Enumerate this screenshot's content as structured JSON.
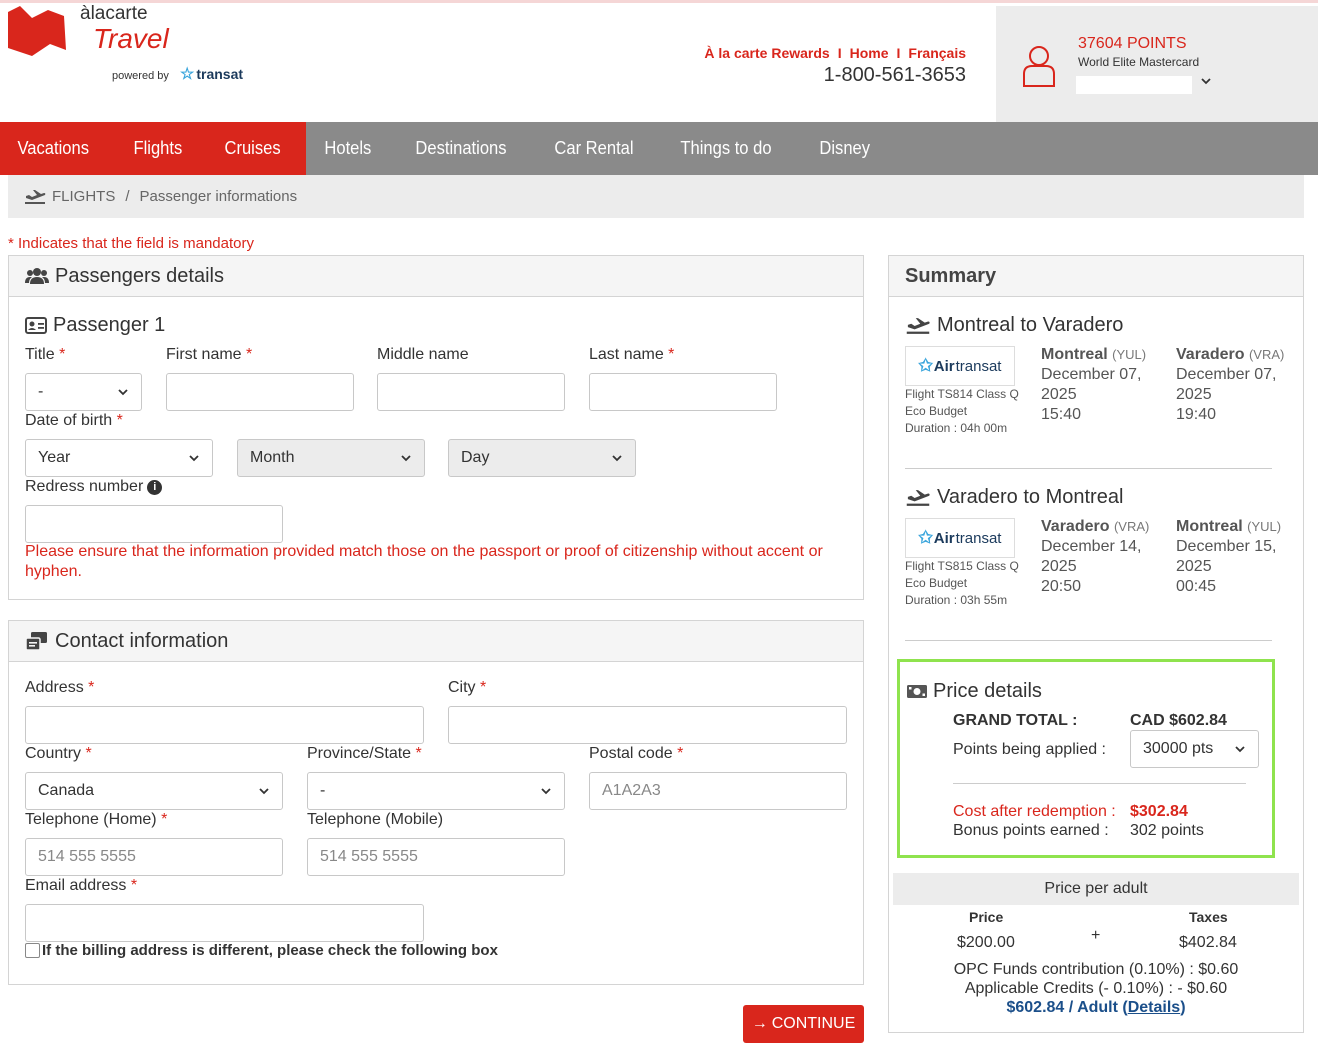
{
  "brand": {
    "ala": "àlacarte",
    "travel": "Travel",
    "powered_by": "powered by",
    "transat": "transat"
  },
  "top_links": {
    "rewards": "À la carte Rewards",
    "home": "Home",
    "language": "Français",
    "separator": "I",
    "phone": "1-800-561-3653"
  },
  "account": {
    "points": "37604 POINTS",
    "card": "World Elite Mastercard"
  },
  "nav": {
    "items": [
      "Vacations",
      "Flights",
      "Cruises",
      "Hotels",
      "Destinations",
      "Car Rental",
      "Things to do",
      "Disney"
    ]
  },
  "breadcrumb": {
    "section": "FLIGHTS",
    "separator": "/",
    "current": "Passenger informations"
  },
  "mandatory_note": "* Indicates that the field is mandatory",
  "passengers": {
    "title": "Passengers details",
    "passenger_title": "Passenger 1",
    "title_label": "Title",
    "title_value": "-",
    "first_name_label": "First name",
    "middle_name_label": "Middle name",
    "last_name_label": "Last name",
    "dob_label": "Date of birth",
    "dob_year": "Year",
    "dob_month": "Month",
    "dob_day": "Day",
    "redress_label": "Redress number",
    "info_glyph": "i",
    "warning": "Please ensure that the information provided match those on the passport or proof of citizenship without accent or hyphen.",
    "required_mark": "*"
  },
  "contact": {
    "title": "Contact information",
    "address_label": "Address",
    "city_label": "City",
    "country_label": "Country",
    "country_value": "Canada",
    "province_label": "Province/State",
    "province_value": "-",
    "postal_label": "Postal code",
    "postal_placeholder": "A1A2A3",
    "tel_home_label": "Telephone (Home)",
    "tel_home_placeholder": "514 555 5555",
    "tel_mobile_label": "Telephone (Mobile)",
    "tel_mobile_placeholder": "514 555 5555",
    "email_label": "Email address",
    "billing_checkbox": "If the billing address is different, please check the following box"
  },
  "continue_button": {
    "arrow": "→",
    "label": "CONTINUE"
  },
  "summary": {
    "title": "Summary",
    "airline": {
      "air": "Air",
      "transat": "transat"
    },
    "outbound": {
      "route": "Montreal to Varadero",
      "flight": "Flight TS814 Class Q Eco Budget",
      "duration": "Duration : 04h 00m",
      "from_city": "Montreal",
      "from_code": "(YUL)",
      "from_date": "December 07, 2025",
      "from_time": "15:40",
      "to_city": "Varadero",
      "to_code": "(VRA)",
      "to_date": "December 07, 2025",
      "to_time": "19:40"
    },
    "return": {
      "route": "Varadero to Montreal",
      "flight": "Flight TS815 Class Q Eco Budget",
      "duration": "Duration : 03h 55m",
      "from_city": "Varadero",
      "from_code": "(VRA)",
      "from_date": "December 14, 2025",
      "from_time": "20:50",
      "to_city": "Montreal",
      "to_code": "(YUL)",
      "to_date": "December 15, 2025",
      "to_time": "00:45"
    },
    "price_details": {
      "title": "Price details",
      "grand_total_label": "GRAND TOTAL :",
      "grand_total_value": "CAD $602.84",
      "points_label": "Points being applied :",
      "points_value": "30000 pts",
      "cost_after_label": "Cost after redemption :",
      "cost_after_value": "$302.84",
      "bonus_label": "Bonus points earned :",
      "bonus_value": "302 points"
    },
    "per_adult": {
      "title": "Price per adult",
      "price_label": "Price",
      "price_value": "$200.00",
      "plus": "+",
      "taxes_label": "Taxes",
      "taxes_value": "$402.84",
      "opc": "OPC Funds contribution (0.10%) : $0.60",
      "credits": "Applicable Credits (- 0.10%) : - $0.60",
      "total": "$602.84 / Adult",
      "details_open": "(",
      "details_link": "Details",
      "details_close": ")"
    }
  },
  "colors": {
    "brand_red": "#d9261c",
    "nav_grey": "#8a8a8a",
    "highlight_green": "#8fe34e",
    "link_blue": "#1b4f8a"
  }
}
